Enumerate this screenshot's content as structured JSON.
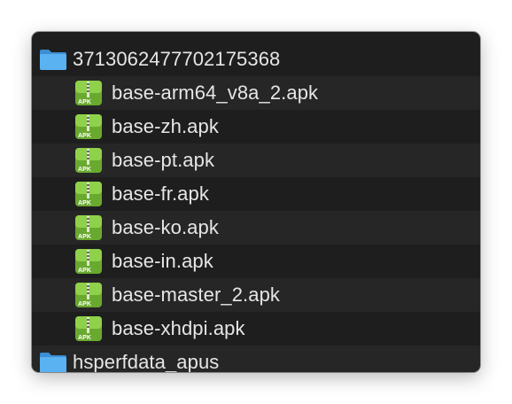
{
  "window": {
    "rows": [
      {
        "type": "folder",
        "name": "3713062477702175368",
        "icon": "folder-icon"
      },
      {
        "type": "apk",
        "name": "base-arm64_v8a_2.apk",
        "icon": "apk-file-icon"
      },
      {
        "type": "apk",
        "name": "base-zh.apk",
        "icon": "apk-file-icon"
      },
      {
        "type": "apk",
        "name": "base-pt.apk",
        "icon": "apk-file-icon"
      },
      {
        "type": "apk",
        "name": "base-fr.apk",
        "icon": "apk-file-icon"
      },
      {
        "type": "apk",
        "name": "base-ko.apk",
        "icon": "apk-file-icon"
      },
      {
        "type": "apk",
        "name": "base-in.apk",
        "icon": "apk-file-icon"
      },
      {
        "type": "apk",
        "name": "base-master_2.apk",
        "icon": "apk-file-icon"
      },
      {
        "type": "apk",
        "name": "base-xhdpi.apk",
        "icon": "apk-file-icon"
      },
      {
        "type": "folder",
        "name": "hsperfdata_apus",
        "icon": "folder-icon"
      }
    ],
    "apk_badge_text": "APK",
    "colors": {
      "background": "#1e1e1e",
      "alternate_row": "#262626",
      "text": "#e6e6e6",
      "folder": "#4aa3e8",
      "apk_green": "#7cbf3a"
    }
  }
}
